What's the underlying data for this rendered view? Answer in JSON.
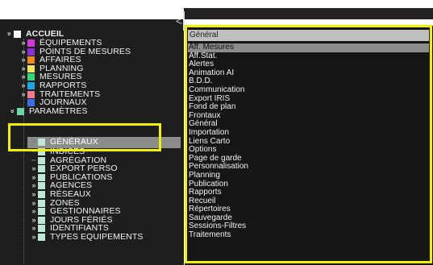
{
  "tree": {
    "root_label": "ACCUEIL",
    "items": [
      {
        "label": "ÉQUIPEMENTS",
        "color": "#d63ad6"
      },
      {
        "label": "POINTS DE MESURES",
        "color": "#8f2fd6"
      },
      {
        "label": "AFFAIRES",
        "color": "#f08a1a"
      },
      {
        "label": "PLANNING",
        "color": "#f5e65a"
      },
      {
        "label": "MESURES",
        "color": "#2fd67a"
      },
      {
        "label": "RAPPORTS",
        "color": "#1aa7e8"
      },
      {
        "label": "TRAITEMENTS",
        "color": "#f57a8c"
      },
      {
        "label": "JOURNAUX",
        "color": "#3a6fe8"
      },
      {
        "label": "PARAMÈTRES",
        "color": "#6fd6a8"
      }
    ],
    "sub_items": [
      {
        "label": "GÉNÉRAUX",
        "color": "#bfe8d6"
      },
      {
        "label": "INDICES",
        "color": "#bfe8d6"
      },
      {
        "label": "AGRÉGATION",
        "color": "#bfe8d6"
      },
      {
        "label": "EXPORT PERSO",
        "color": "#bfe8d6"
      },
      {
        "label": "PUBLICATIONS",
        "color": "#bfe8d6"
      },
      {
        "label": "AGENCES",
        "color": "#bfe8d6"
      },
      {
        "label": "RÉSEAUX",
        "color": "#bfe8d6"
      },
      {
        "label": "ZONES",
        "color": "#bfe8d6"
      },
      {
        "label": "GESTIONNAIRES",
        "color": "#bfe8d6"
      },
      {
        "label": "JOURS FÉRIÉS",
        "color": "#bfe8d6"
      },
      {
        "label": "IDENTIFIANTS",
        "color": "#bfe8d6"
      },
      {
        "label": "TYPES EQUIPEMENTS",
        "color": "#bfe8d6"
      }
    ],
    "collapse_glyph": "<"
  },
  "panel": {
    "dropdown_value": "Général",
    "items": [
      "Aff. Mesures",
      "Aff.Stat.",
      "Alertes",
      "Animation AI",
      "B.D.D.",
      "Communication",
      "Export IRIS",
      "Fond de plan",
      "Frontaux",
      "Général",
      "Importation",
      "Liens Carto",
      "Options",
      "Page de garde",
      "Personnalisation",
      "Planning",
      "Publication",
      "Rapports",
      "Recueil",
      "Répertoires",
      "Sauvegarde",
      "Sessions-Filtres",
      "Traitements"
    ],
    "active_item": "Aff. Mesures"
  },
  "colors": {
    "highlight": "#f2f200",
    "selection": "#8c8c8c",
    "background": "#1e1e1e"
  }
}
